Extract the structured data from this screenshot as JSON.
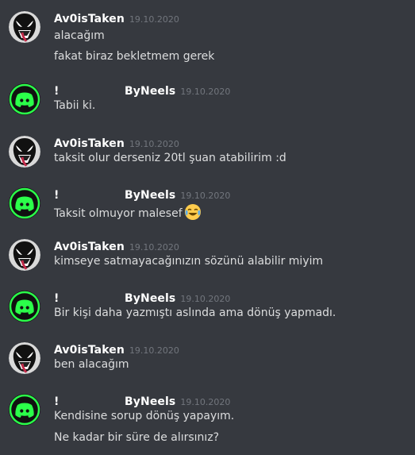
{
  "messages": [
    {
      "author": "Av0isTaken",
      "prefix": "",
      "timestamp": "19.10.2020",
      "avatar_icon": "venom-avatar",
      "lines": [
        "alacağım",
        "fakat biraz bekletmem gerek"
      ]
    },
    {
      "author": "ByNeels",
      "prefix": "!",
      "timestamp": "19.10.2020",
      "avatar_icon": "discord-logo-avatar",
      "lines": [
        "Tabii ki."
      ]
    },
    {
      "author": "Av0isTaken",
      "prefix": "",
      "timestamp": "19.10.2020",
      "avatar_icon": "venom-avatar",
      "lines": [
        "taksit olur derseniz 20tl şuan atabilirim :d"
      ]
    },
    {
      "author": "ByNeels",
      "prefix": "!",
      "timestamp": "19.10.2020",
      "avatar_icon": "discord-logo-avatar",
      "lines": [
        "Taksit olmuyor malesef"
      ],
      "emoji": "joy-tears-emoji"
    },
    {
      "author": "Av0isTaken",
      "prefix": "",
      "timestamp": "19.10.2020",
      "avatar_icon": "venom-avatar",
      "lines": [
        "kimseye satmayacağınızın sözünü alabilir miyim"
      ]
    },
    {
      "author": "ByNeels",
      "prefix": "!",
      "timestamp": "19.10.2020",
      "avatar_icon": "discord-logo-avatar",
      "lines": [
        "Bir kişi daha yazmıştı aslında ama dönüş yapmadı."
      ]
    },
    {
      "author": "Av0isTaken",
      "prefix": "",
      "timestamp": "19.10.2020",
      "avatar_icon": "venom-avatar",
      "lines": [
        "ben alacağım"
      ]
    },
    {
      "author": "ByNeels",
      "prefix": "!",
      "timestamp": "19.10.2020",
      "avatar_icon": "discord-logo-avatar",
      "lines": [
        "Kendisine sorup dönüş yapayım.",
        "Ne kadar bir süre de alırsınız?"
      ]
    }
  ],
  "colors": {
    "background": "#36393f",
    "username": "#ffffff",
    "timestamp": "#72767d",
    "message_text": "#dcddde",
    "discord_green": "#3ba55c"
  }
}
